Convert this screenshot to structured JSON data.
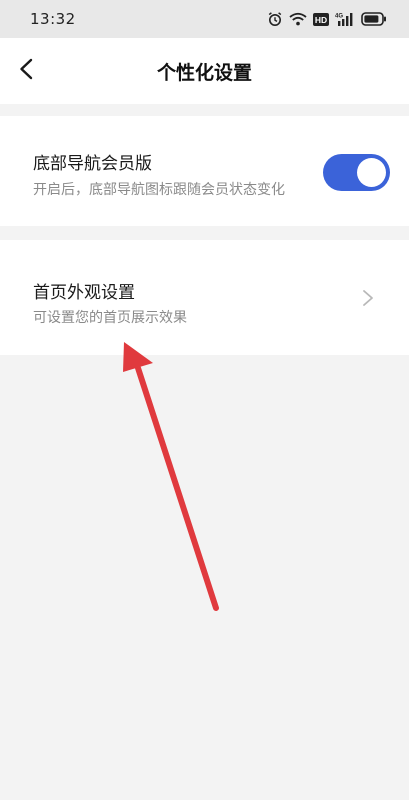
{
  "status_bar": {
    "time": "13:32",
    "icons": [
      "alarm-icon",
      "wifi-icon",
      "hd-icon",
      "signal-4g-icon",
      "battery-icon"
    ],
    "hd_label": "HD",
    "network_label": "4G"
  },
  "header": {
    "title": "个性化设置",
    "back_icon": "chevron-left-icon"
  },
  "settings": {
    "bottom_nav_member": {
      "title": "底部导航会员版",
      "description": "开启后，底部导航图标跟随会员状态变化",
      "enabled": true
    },
    "home_appearance": {
      "title": "首页外观设置",
      "description": "可设置您的首页展示效果"
    }
  },
  "colors": {
    "toggle_on": "#3b63d9",
    "annotation_arrow": "#e03a3e",
    "page_background": "#f3f3f3"
  }
}
